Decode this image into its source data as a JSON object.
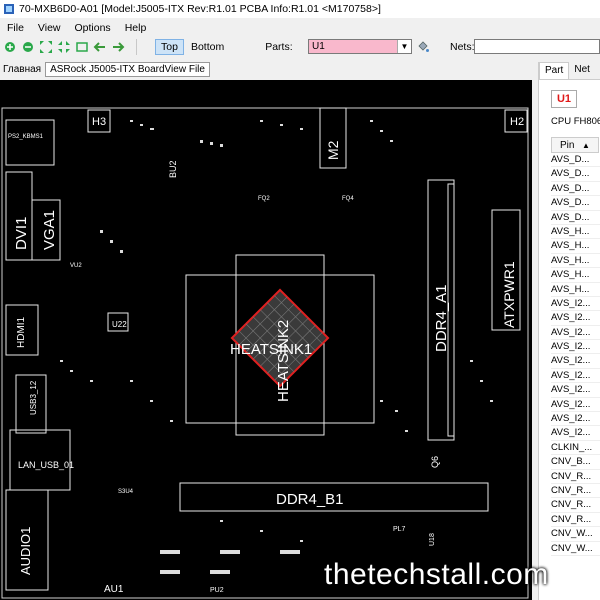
{
  "window": {
    "title": "70-MXB6D0-A01 [Model:J5005-ITX Rev:R1.01 PCBA Info:R1.01  <M170758>]"
  },
  "menu": [
    "File",
    "View",
    "Options",
    "Help"
  ],
  "toolbar": {
    "top_label": "Top",
    "bottom_label": "Bottom",
    "parts_label": "Parts:",
    "parts_value": "U1",
    "nets_label": "Nets:"
  },
  "tabs": {
    "home": "Главная",
    "document": "ASRock J5005-ITX BoardView File"
  },
  "side_panel": {
    "tabs": [
      "Part",
      "Net"
    ],
    "selected_part": "U1",
    "part_desc": "CPU FH806",
    "pin_header": "Pin",
    "pins": [
      "AVS_D...",
      "AVS_D...",
      "AVS_D...",
      "AVS_D...",
      "AVS_D...",
      "AVS_H...",
      "AVS_H...",
      "AVS_H...",
      "AVS_H...",
      "AVS_H...",
      "AVS_I2...",
      "AVS_I2...",
      "AVS_I2...",
      "AVS_I2...",
      "AVS_I2...",
      "AVS_I2...",
      "AVS_I2...",
      "AVS_I2...",
      "AVS_I2...",
      "AVS_I2...",
      "CLKIN_...",
      "CNV_B...",
      "CNV_R...",
      "CNV_R...",
      "CNV_R...",
      "CNV_R...",
      "CNV_W...",
      "CNV_W..."
    ]
  },
  "board_labels": {
    "h3": "H3",
    "h2": "H2",
    "ps2": "PS2_KBMS1",
    "dvi": "DVI1",
    "vga": "VGA1",
    "hdmi": "HDMI1",
    "usb3": "USB3_12",
    "lan": "LAN_USB_01",
    "audio": "AUDIO1",
    "au1": "AU1",
    "bu2": "BU2",
    "m2": "M2",
    "u22": "U22",
    "heatsink1": "HEATSINK1",
    "heatsink2": "HEATSINK2",
    "ddr4a": "DDR4_A1",
    "ddr4b": "DDR4_B1",
    "atx": "ATXPWR1",
    "q6": "Q6",
    "vu2": "VU2",
    "pl7": "PL7",
    "u18": "U18",
    "pu2": "PU2",
    "s3u4": "S3U4",
    "fq2": "FQ2",
    "fq4": "FQ4"
  },
  "watermark": "thetechstall.com"
}
